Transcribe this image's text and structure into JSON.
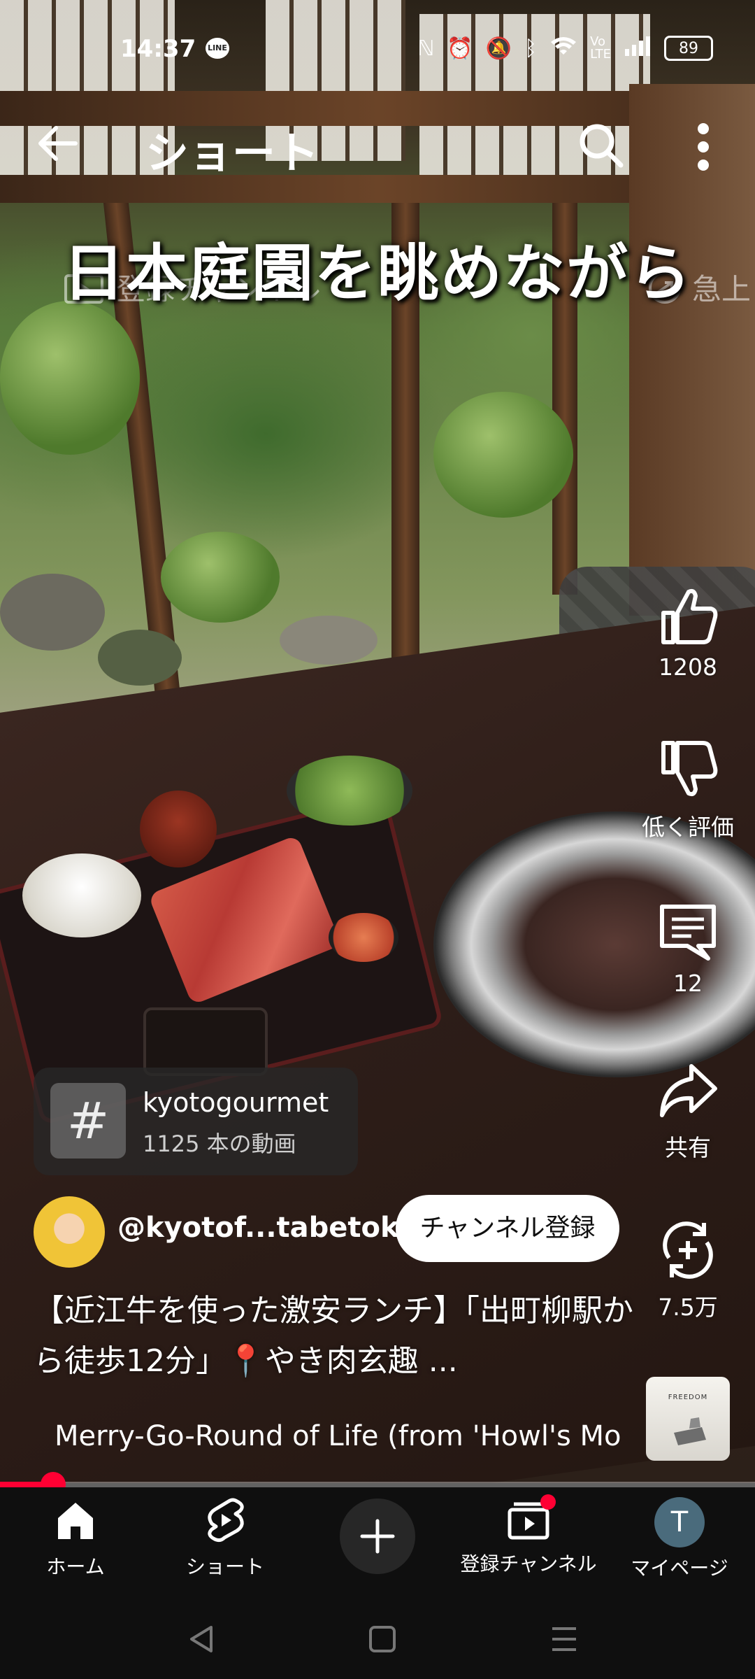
{
  "status_bar": {
    "time": "14:37",
    "line_label": "LINE",
    "battery": "89"
  },
  "toolbar": {
    "title": "ショート"
  },
  "video": {
    "overlay_title": "日本庭園を眺めながら",
    "ghost_left": "登録チャンネル",
    "ghost_right": "急上"
  },
  "actions": {
    "like_count": "1208",
    "dislike_label": "低く評価",
    "comment_count": "12",
    "share_label": "共有",
    "remix_count": "7.5万"
  },
  "hashtag": {
    "symbol": "#",
    "name": "kyotogourmet",
    "count": "1125 本の動画"
  },
  "channel": {
    "handle": "@kyotof...tabetoku",
    "subscribe_label": "チャンネル登録"
  },
  "description": "【近江牛を使った激安ランチ】「出町柳駅から徒歩12分」📍やき肉玄趣 ...",
  "music": {
    "title": "Merry-Go-Round of Life (from 'Howl's Mov",
    "album_text": "FREEDOM"
  },
  "progress": {
    "fraction": 0.07
  },
  "bottom_nav": {
    "home": "ホーム",
    "shorts": "ショート",
    "subscriptions": "登録チャンネル",
    "mypage": "マイページ",
    "account_initial": "T"
  },
  "colors": {
    "accent": "#ff0033",
    "background": "#0f0f0f"
  }
}
